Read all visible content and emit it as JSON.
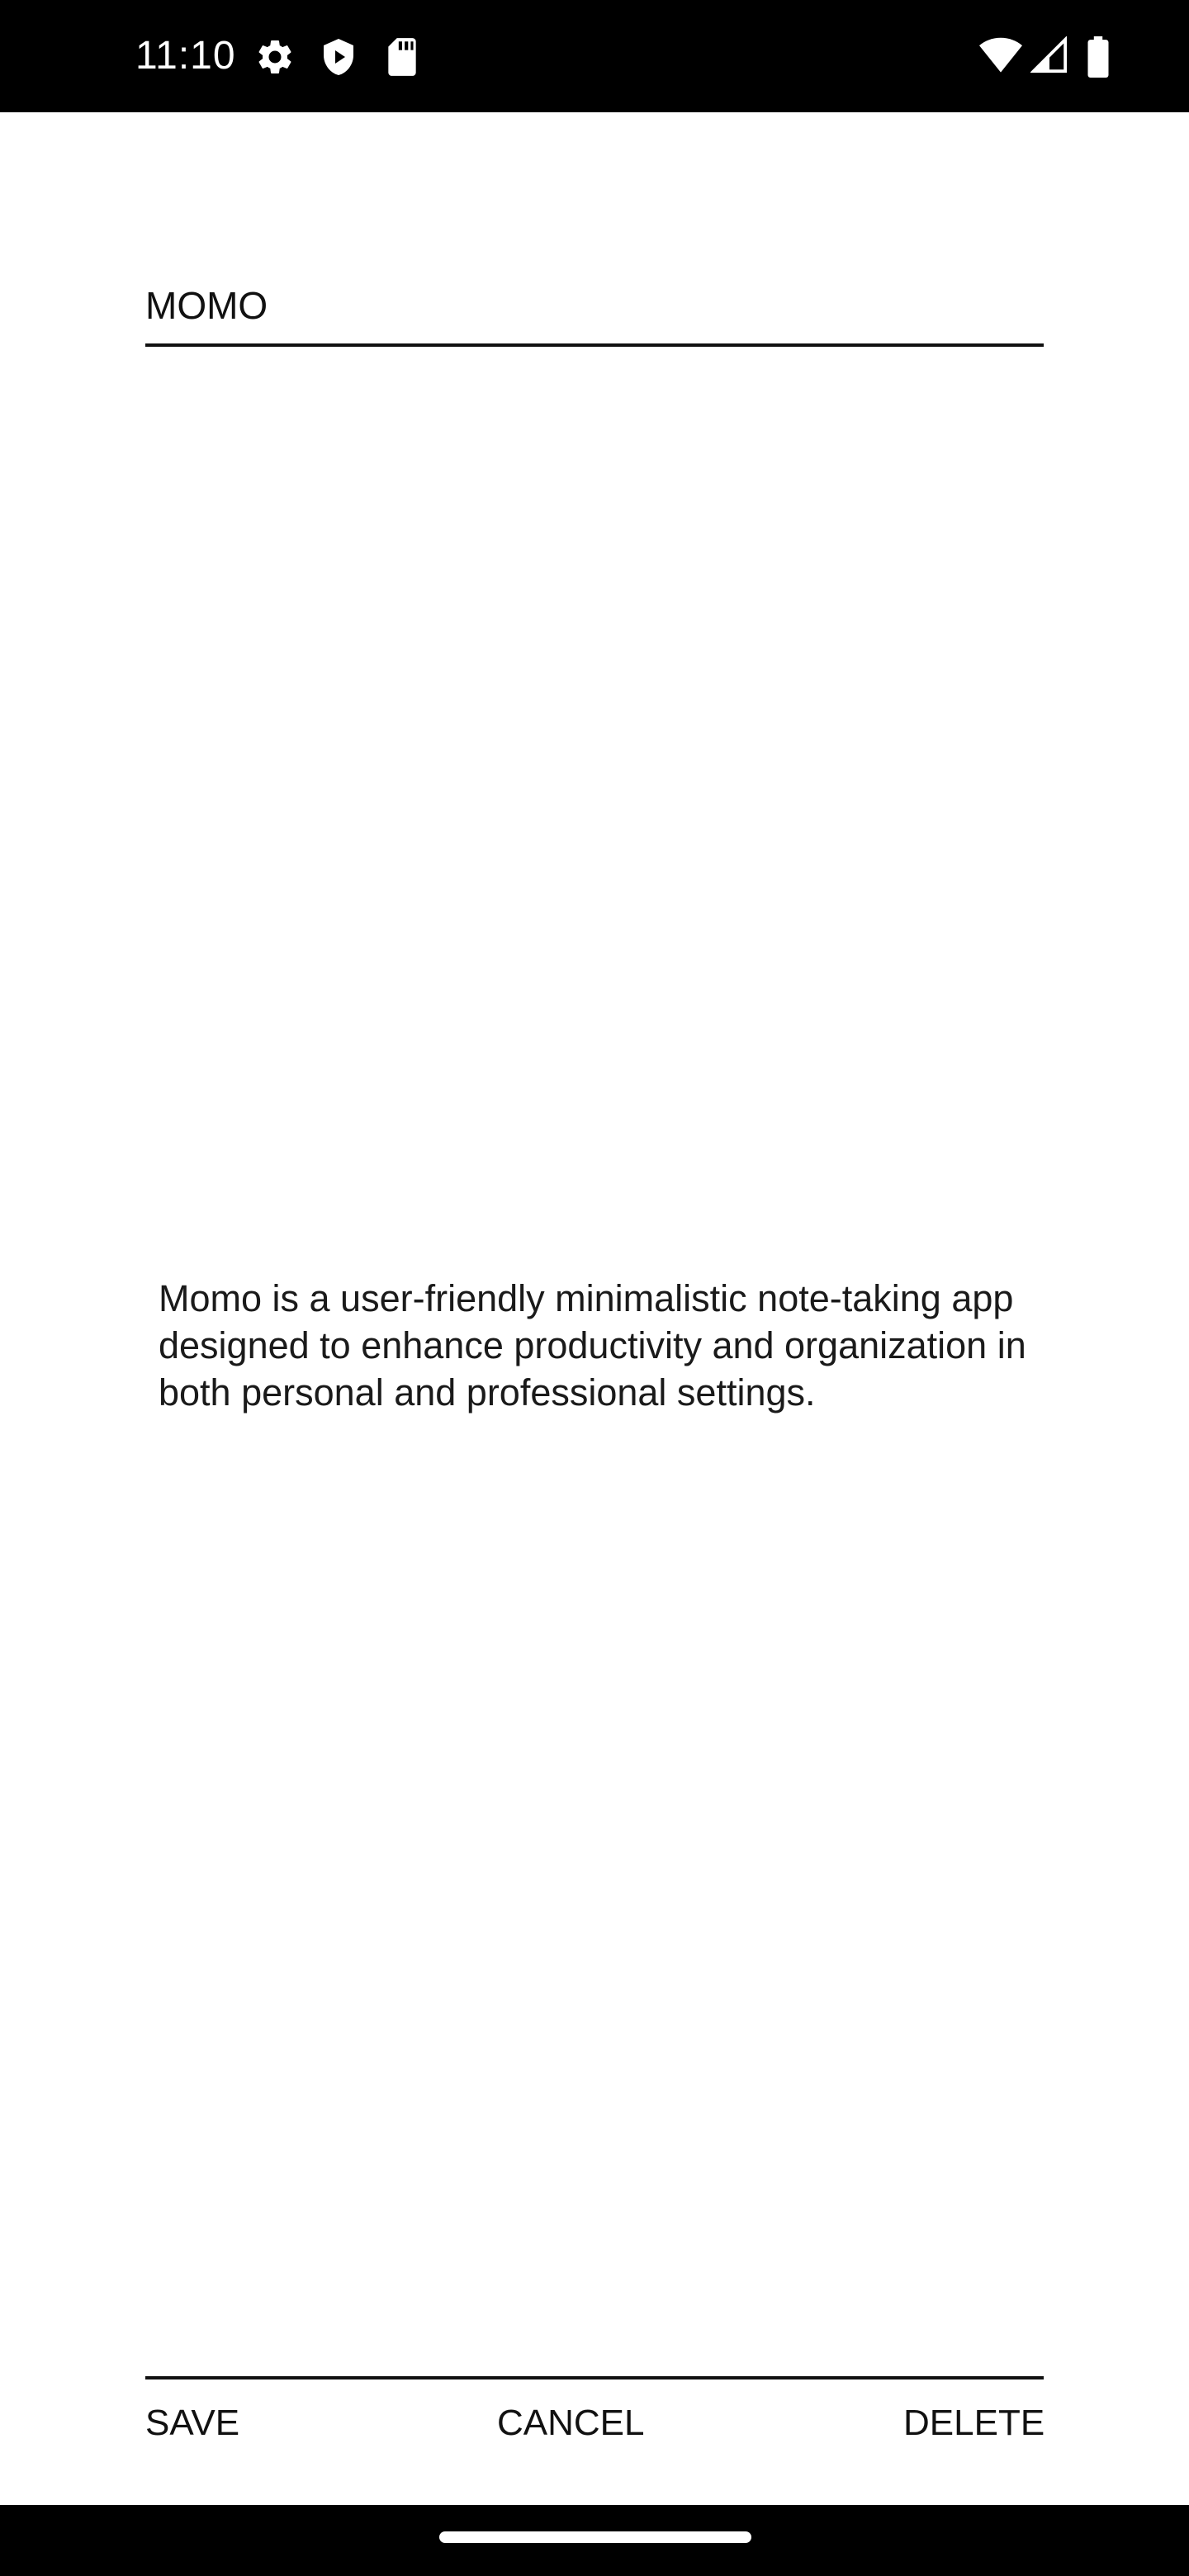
{
  "status_bar": {
    "time": "11:10",
    "left_icons": [
      "gear-icon",
      "shield-play-icon",
      "sd-card-icon"
    ],
    "right_icons": [
      "wifi-icon",
      "signal-icon",
      "battery-icon"
    ]
  },
  "note": {
    "title": "MOMO",
    "body": "Momo is a user-friendly minimalistic note-taking app designed to enhance productivity and organization in both personal and professional settings."
  },
  "actions": {
    "save_label": "SAVE",
    "cancel_label": "CANCEL",
    "delete_label": "DELETE"
  },
  "colors": {
    "background": "#ffffff",
    "bars": "#000000",
    "text": "#111111"
  }
}
